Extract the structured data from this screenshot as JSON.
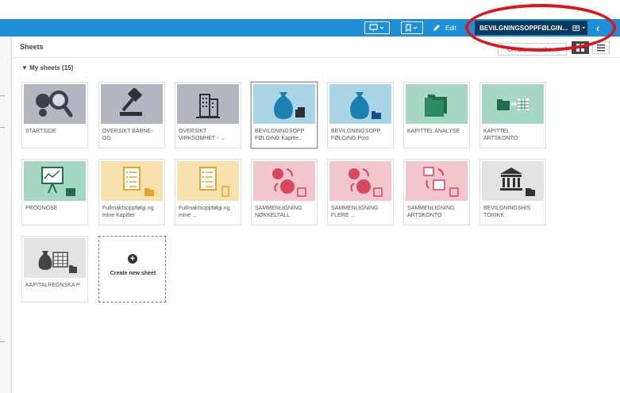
{
  "toolbar": {
    "edit_label": "Edit",
    "current_sheet": "BEVILGNINGSOPPFØLGIN...",
    "icons": [
      "presentation-icon",
      "bookmark-icon",
      "pencil-icon",
      "sheet-icon",
      "chevron-left-icon"
    ]
  },
  "panel": {
    "title": "Sheets",
    "create_button": "Create new sheet",
    "section": "▼ My sheets (15)"
  },
  "sheets": [
    {
      "label": "STARTSIDE",
      "icon": "magnifier-dots-icon",
      "bg": "#b3b5c0"
    },
    {
      "label": "OVERSIKT BARNE- OG",
      "icon": "gavel-icon",
      "bg": "#b3b5c0"
    },
    {
      "label": "OVERSIKT VIRKSOMHET - ...",
      "icon": "building-icon",
      "bg": "#b3b5c0"
    },
    {
      "label": "BEVILGNINGSOPP FØLGING Kapitte..",
      "icon": "moneybag-icon",
      "bg": "#a9d5e6"
    },
    {
      "label": "BEVILGNINGSOPP FØLGING Post",
      "icon": "moneybag-icon",
      "bg": "#a9d5e6"
    },
    {
      "label": "KAPITTEL ANALYSE",
      "icon": "folders-icon",
      "bg": "#a6d6c4"
    },
    {
      "label": "KAPITTEL ARTSKONTO",
      "icon": "folder-exchange-icon",
      "bg": "#a6d6c4"
    },
    {
      "label": "PROGNOSE",
      "icon": "chart-board-icon",
      "bg": "#a6d6c4"
    },
    {
      "label": "Fullmaktsoppfølgi ng mine Kapitler",
      "icon": "checklist-icon",
      "bg": "#f7e2ae"
    },
    {
      "label": "Fullmaktsoppfølgi ng mine ...",
      "icon": "checklist-icon",
      "bg": "#f7e2ae"
    },
    {
      "label": "SAMMENLIGNING NØKKELTALL",
      "icon": "compare-numbers-icon",
      "bg": "#f1c7cd"
    },
    {
      "label": "SAMMENLIGNING FLERE ...",
      "icon": "compare-numbers-icon",
      "bg": "#f1c7cd"
    },
    {
      "label": "SAMMENLIGNING ARTSKONTO",
      "icon": "compare-table-icon",
      "bg": "#f1c7cd"
    },
    {
      "label": "BEVILGNINGSHIS TORIKK",
      "icon": "bank-icon",
      "bg": "#e3e3e3"
    },
    {
      "label": "KAPITALREGNSKA P",
      "icon": "moneybag-table-icon",
      "bg": "#e3e3e3"
    }
  ],
  "create_card": {
    "label": "Create new sheet"
  }
}
